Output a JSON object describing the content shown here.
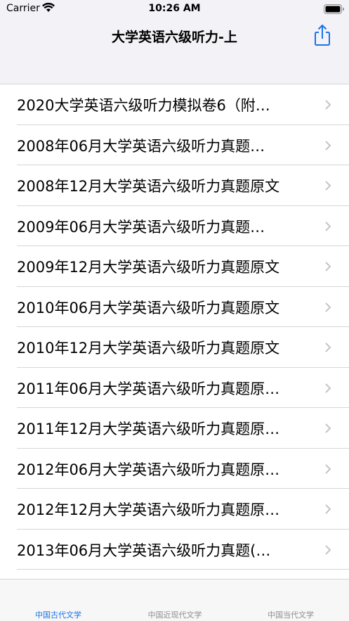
{
  "status": {
    "carrier": "Carrier",
    "time": "10:26 AM"
  },
  "nav": {
    "title": "大学英语六级听力-上"
  },
  "list": [
    "2020大学英语六级听力模拟卷6（附…",
    "2008年06月大学英语六级听力真题…",
    "2008年12月大学英语六级听力真题原文",
    "2009年06月大学英语六级听力真题…",
    "2009年12月大学英语六级听力真题原文",
    "2010年06月大学英语六级听力真题原文",
    "2010年12月大学英语六级听力真题原文",
    "2011年06月大学英语六级听力真题原…",
    "2011年12月大学英语六级听力真题原…",
    "2012年06月大学英语六级听力真题原…",
    "2012年12月大学英语六级听力真题原…",
    "2013年06月大学英语六级听力真题(…"
  ],
  "tabs": [
    {
      "label": "中国古代文学"
    },
    {
      "label": "中国近现代文学"
    },
    {
      "label": "中国当代文学"
    }
  ],
  "colors": {
    "accent": "#1a73e8",
    "inactive": "#8e8e93"
  }
}
